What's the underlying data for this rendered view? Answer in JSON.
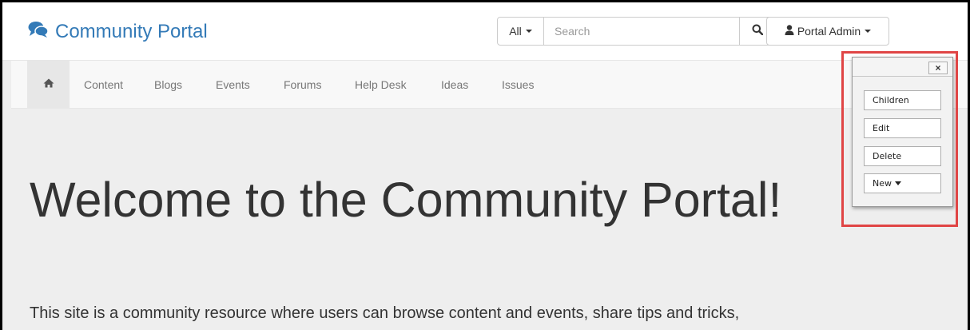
{
  "header": {
    "brand": "Community Portal",
    "search_scope": "All",
    "search_placeholder": "Search",
    "user_menu": "Portal Admin"
  },
  "nav": {
    "items": [
      "Content",
      "Blogs",
      "Events",
      "Forums",
      "Help Desk",
      "Ideas",
      "Issues"
    ]
  },
  "hero": {
    "title": "Welcome to the Community Portal!",
    "text": "This site is a community resource where users can browse content and events, share tips and tricks,"
  },
  "admin_toolbar": {
    "close": "×",
    "buttons": [
      "Children",
      "Edit",
      "Delete",
      "New"
    ]
  },
  "colors": {
    "brand": "#337ab7",
    "highlight": "#e04545",
    "nav_text": "#777777"
  },
  "icons": {
    "brand": "comments-icon",
    "home": "home-icon",
    "search": "search-icon",
    "user": "user-icon"
  }
}
